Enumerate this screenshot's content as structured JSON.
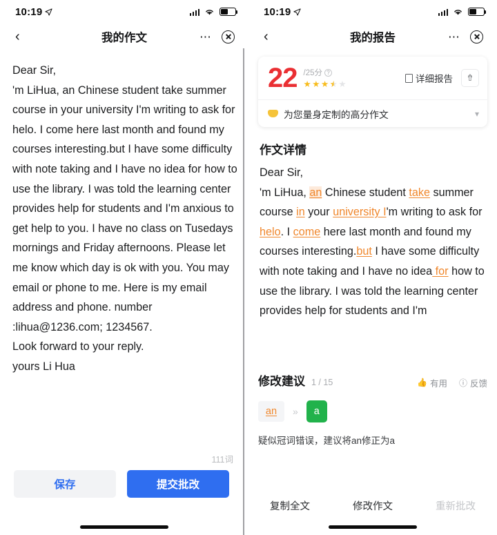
{
  "status_bar": {
    "time": "10:19",
    "location_icon": "location-arrow-icon",
    "signal_icon": "signal-dots-icon",
    "wifi_icon": "wifi-icon",
    "battery_icon": "battery-icon",
    "battery_level": 52
  },
  "left_panel": {
    "nav": {
      "back_icon": "chevron-left-icon",
      "title": "我的作文",
      "more_icon": "more-dots-icon",
      "close_icon": "close-circle-icon"
    },
    "essay_text": "Dear Sir,\n'm LiHua, an Chinese student take summer course in your university I'm writing to ask for helo. I come here last month and found my courses interesting.but I have some difficulty with note taking and I have no idea for how to use the library. I was told the learning center provides help for students and I'm anxious to get help to you. I have no class on Tusedays mornings and Friday afternoons. Please let me know which day is ok with you. You may email or phone to me. Here is my email address and phone. number :lihua@1236.com; 1234567.\nLook forward to your reply.\nyours Li Hua",
    "word_count": "111词",
    "save_label": "保存",
    "submit_label": "提交批改"
  },
  "right_panel": {
    "nav": {
      "back_icon": "chevron-left-icon",
      "title": "我的报告",
      "more_icon": "more-dots-icon",
      "close_icon": "close-circle-icon"
    },
    "score_card": {
      "score": "22",
      "total": "/25分",
      "help_icon": "question-mark-icon",
      "stars_filled": 3,
      "stars_half": 1,
      "stars_total": 5,
      "report_label": "详细报告",
      "report_icon": "document-icon",
      "share_icon": "share-upload-icon",
      "promo_icon": "diamond-icon",
      "promo_text": "为您量身定制的高分作文",
      "promo_chevron_icon": "chevron-down-icon"
    },
    "detail_title": "作文详情",
    "essay_segments": [
      {
        "t": "Dear Sir,\n'm LiHua, ",
        "k": "plain"
      },
      {
        "t": "an",
        "k": "error-hl"
      },
      {
        "t": " Chinese student ",
        "k": "plain"
      },
      {
        "t": "take",
        "k": "error"
      },
      {
        "t": " summer course ",
        "k": "plain"
      },
      {
        "t": "in",
        "k": "error"
      },
      {
        "t": " your ",
        "k": "plain"
      },
      {
        "t": "university I",
        "k": "error"
      },
      {
        "t": "'m writing to ask for ",
        "k": "plain"
      },
      {
        "t": "helo",
        "k": "error"
      },
      {
        "t": ". I ",
        "k": "plain"
      },
      {
        "t": "come",
        "k": "error"
      },
      {
        "t": " here last month and found my courses interesting.",
        "k": "plain"
      },
      {
        "t": "but",
        "k": "error"
      },
      {
        "t": " I have some difficulty with note taking and I have no idea",
        "k": "plain"
      },
      {
        "t": " for",
        "k": "error"
      },
      {
        "t": " how to use the library. I was told the learning center provides help for students and I'm",
        "k": "plain"
      }
    ],
    "suggestion": {
      "title": "修改建议",
      "count": "1 / 15",
      "useful_icon": "thumbs-up-icon",
      "useful_label": "有用",
      "feedback_icon": "exclamation-circle-icon",
      "feedback_label": "反馈",
      "old_word": "an",
      "arrow_icon": "double-chevron-right-icon",
      "new_word": "a",
      "description": "疑似冠词错误，建议将an修正为a"
    },
    "bottom_actions": [
      {
        "label": "复制全文",
        "disabled": false
      },
      {
        "label": "修改作文",
        "disabled": false
      },
      {
        "label": "重新批改",
        "disabled": true
      }
    ]
  },
  "colors": {
    "score_red": "#ea2f33",
    "primary_blue": "#2f6ef0",
    "error_orange": "#f0872c",
    "correct_green": "#21b24b",
    "star_yellow": "#f8bc1c"
  }
}
